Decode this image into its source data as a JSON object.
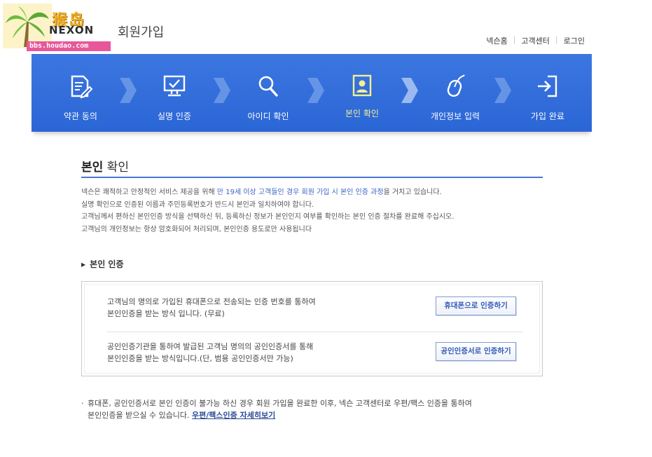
{
  "watermark": {
    "title": "猴岛",
    "url": "bbs.houdao.com"
  },
  "header": {
    "logo": "NEXON",
    "page_title": "회원가입",
    "links": [
      "넥슨홈",
      "고객센터",
      "로그인"
    ]
  },
  "steps": [
    {
      "label": "약관 동의",
      "icon": "document-pen-icon",
      "active": false
    },
    {
      "label": "실명 인증",
      "icon": "monitor-check-icon",
      "active": false
    },
    {
      "label": "아이디 확인",
      "icon": "magnifier-icon",
      "active": false
    },
    {
      "label": "본인 확인",
      "icon": "person-id-icon",
      "active": true
    },
    {
      "label": "개인정보 입력",
      "icon": "mouse-icon",
      "active": false
    },
    {
      "label": "가입 완료",
      "icon": "enter-door-icon",
      "active": false
    }
  ],
  "colors": {
    "banner": "#2f6bdb",
    "active_step": "#f4f090",
    "accent_line": "#4a76d6",
    "button_text": "#3059b5"
  },
  "section": {
    "title_bold": "본인",
    "title_rest": " 확인",
    "intro": {
      "line1_pre": "넥슨은 쾌적하고 안정적인 서비스 제공을 위해 ",
      "line1_hl": "만 19세 이상 고객들인 경우 회원 가입 시 본인 인증 과정",
      "line1_post": "을 거치고 있습니다.",
      "line2": "실명 확인으로 인증된 이름과 주민등록번호가 반드시 본인과 일치하여야 합니다.",
      "line3": "고객님께서 편하신 본인인증 방식을 선택하신 뒤, 등록하신 정보가 본인인지 여부를 확인하는 본인 인증 절차를 완료해 주십시오.",
      "line4": "고객님의 개인정보는 항상 암호화되어 처리되며, 본인인증 용도로만 사용됩니다"
    }
  },
  "verify": {
    "title": "본인 인증",
    "options": [
      {
        "line1": "고객님의 명의로 가입된 휴대폰으로 전송되는 인증 번호를 통하여",
        "line2": "본인인증을 받는 방식 입니다. (무료)",
        "button": "휴대폰으로 인증하기"
      },
      {
        "line1": "공인인증기관을 통하여 발급된 고객님 명의의 공인인증서를 통해",
        "line2": "본인인증을 받는 방식입니다.(단, 범용 공인인증서만 가능)",
        "button": "공인인증서로 인증하기"
      }
    ]
  },
  "note": {
    "bullet": "·",
    "line1": "휴대폰, 공인인증서로 본인 인증이 불가능 하신 경우 회원 가입을 완료한 이후, 넥슨 고객센터로 우편/팩스 인증을 통하여",
    "line2": "본인인증을 받으실 수 있습니다. ",
    "link": "우편/팩스인증 자세히보기"
  }
}
